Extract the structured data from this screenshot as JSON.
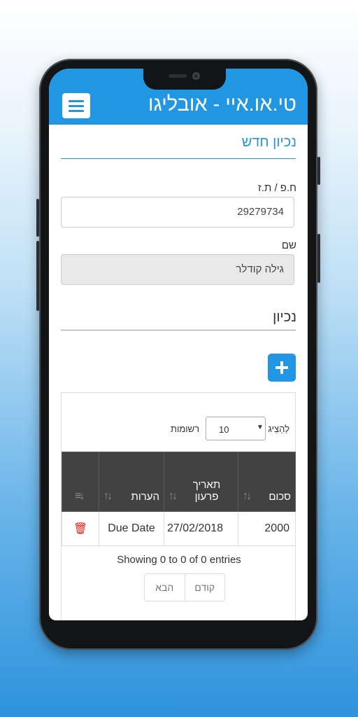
{
  "header": {
    "title": "טי.או.איי - אובליגו"
  },
  "page": {
    "section_title": "נכיון חדש"
  },
  "form": {
    "id_label": "ח.פ / ת.ז",
    "id_value": "29279734",
    "name_label": "שם",
    "name_value": "גילה קודלר",
    "discount_title": "נכיון"
  },
  "table": {
    "show_label": "לְהַצִיג",
    "entries_label": "רשומות",
    "page_size": "10",
    "columns": {
      "amount": "סכום",
      "due_date": "תאריך פרעון",
      "notes": "הערות"
    },
    "rows": [
      {
        "amount": "2000",
        "due_date": "27/02/2018",
        "notes": "Due Date"
      }
    ],
    "info": "Showing 0 to 0 of 0 entries",
    "prev_label": "קודם",
    "next_label": "הבא"
  },
  "colors": {
    "accent": "#2196e3",
    "table_header": "#424242",
    "delete": "#d9231c"
  },
  "icons": {
    "menu": "hamburger-menu-icon",
    "add": "plus-icon",
    "delete": "trash-icon",
    "sort": "sort-arrows-icon"
  }
}
